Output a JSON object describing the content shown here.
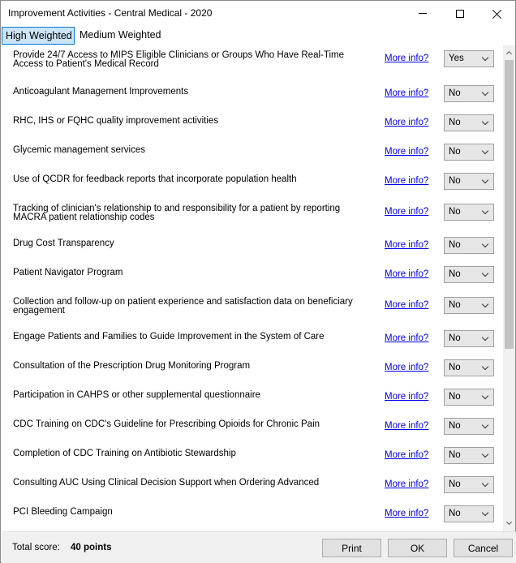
{
  "window": {
    "title": "Improvement Activities - Central Medical - 2020"
  },
  "tabs": [
    {
      "label": "High Weighted",
      "active": true
    },
    {
      "label": "Medium Weighted",
      "active": false
    }
  ],
  "link_label": "More info?",
  "activities": [
    {
      "label": "Provide 24/7 Access to MIPS Eligible Clinicians or Groups Who Have Real-Time Access to Patient's Medical Record",
      "value": "Yes"
    },
    {
      "label": "Anticoagulant Management Improvements",
      "value": "No"
    },
    {
      "label": "RHC, IHS or FQHC quality improvement activities",
      "value": "No"
    },
    {
      "label": "Glycemic management services",
      "value": "No"
    },
    {
      "label": "Use of QCDR for feedback reports that incorporate population health",
      "value": "No"
    },
    {
      "label": "Tracking of clinician's relationship to and responsibility for a patient by reporting MACRA patient relationship codes",
      "value": "No"
    },
    {
      "label": "Drug Cost Transparency",
      "value": "No"
    },
    {
      "label": "Patient Navigator Program",
      "value": "No"
    },
    {
      "label": "Collection and follow-up on patient experience and satisfaction data on beneficiary engagement",
      "value": "No"
    },
    {
      "label": "Engage Patients and Families to Guide Improvement in the System of Care",
      "value": "No"
    },
    {
      "label": "Consultation of the Prescription Drug Monitoring Program",
      "value": "No"
    },
    {
      "label": "Participation in CAHPS or other supplemental questionnaire",
      "value": "No"
    },
    {
      "label": "CDC Training on CDC's Guideline for Prescribing Opioids for Chronic Pain",
      "value": "No"
    },
    {
      "label": "Completion of CDC Training on Antibiotic Stewardship",
      "value": "No"
    },
    {
      "label": "Consulting AUC Using Clinical Decision Support when Ordering Advanced",
      "value": "No"
    },
    {
      "label": "PCI Bleeding Campaign",
      "value": "No"
    }
  ],
  "footer": {
    "score_label": "Total score:",
    "score_value": "40 points",
    "print_label": "Print",
    "ok_label": "OK",
    "cancel_label": "Cancel"
  },
  "icons": {
    "minimize": "minimize-icon",
    "maximize": "maximize-icon",
    "close": "close-icon",
    "dropdown": "chevron-down-icon",
    "scroll_up": "chevron-up-icon",
    "scroll_down": "chevron-down-icon"
  }
}
